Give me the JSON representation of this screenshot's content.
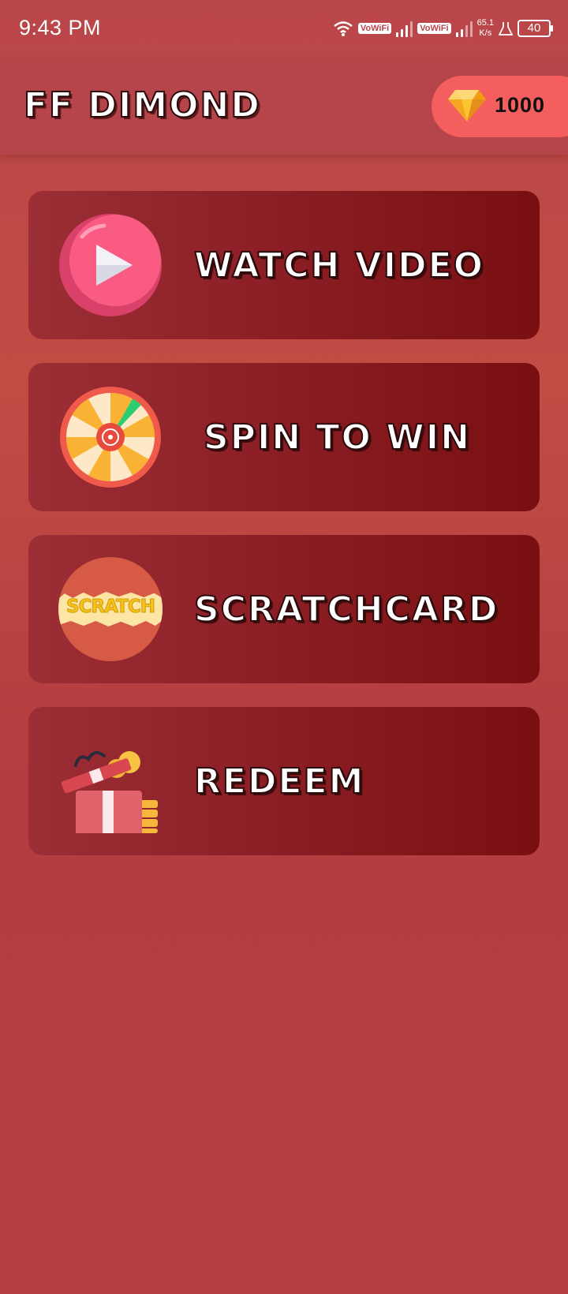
{
  "status_bar": {
    "time": "9:43 PM",
    "vowifi_1": "VoWiFi",
    "vowifi_2": "VoWiFi",
    "net_speed_value": "65.1",
    "net_speed_unit": "K/s",
    "battery": "40"
  },
  "app_bar": {
    "title": "FF DIMOND",
    "coin_icon": "diamond-icon",
    "coin_count": "1000"
  },
  "menu": [
    {
      "label": "WATCH VIDEO",
      "icon": "play-video-icon"
    },
    {
      "label": "SPIN TO WIN",
      "icon": "spin-wheel-icon"
    },
    {
      "label": "SCRATCHCARD",
      "icon": "scratch-icon",
      "icon_text": "SCRATCH"
    },
    {
      "label": "REDEEM",
      "icon": "gift-box-icon"
    }
  ],
  "colors": {
    "background": "#b9464a",
    "app_bar": "#b5454a",
    "coin_pill": "#f55e5e",
    "card_start": "#9c2e36",
    "card_end": "#7a0f12"
  }
}
